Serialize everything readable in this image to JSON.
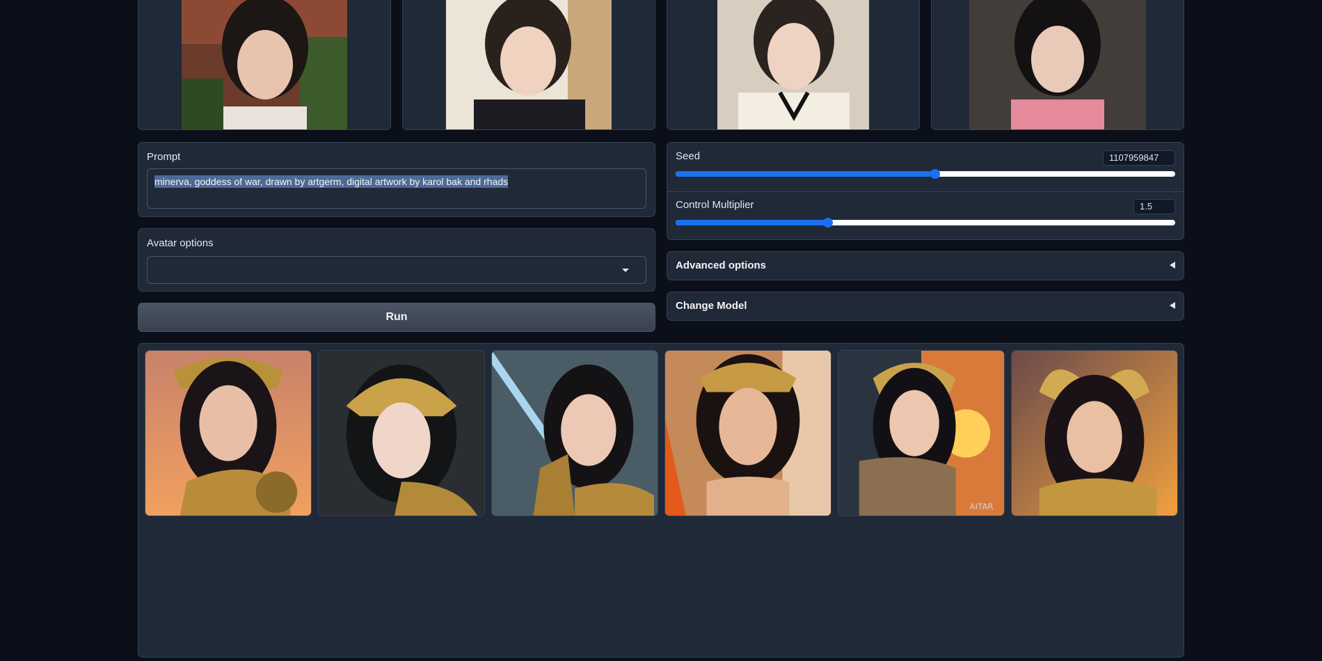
{
  "prompt": {
    "label": "Prompt",
    "value": "minerva, goddess of war, drawn by artgerm, digital artwork by karol bak and rhads"
  },
  "avatar_options": {
    "label": "Avatar options",
    "selected": ""
  },
  "run_button": {
    "label": "Run"
  },
  "seed": {
    "label": "Seed",
    "value": "1107959847",
    "level": 0.52
  },
  "control_multiplier": {
    "label": "Control Multiplier",
    "value": "1.5",
    "level": 0.305
  },
  "advanced_options": {
    "label": "Advanced options"
  },
  "change_model": {
    "label": "Change Model"
  },
  "colors": {
    "background": "#0b0f19",
    "panel": "#1f2937",
    "accent": "#1d6ff2",
    "text_selection": "#4b6a97"
  }
}
